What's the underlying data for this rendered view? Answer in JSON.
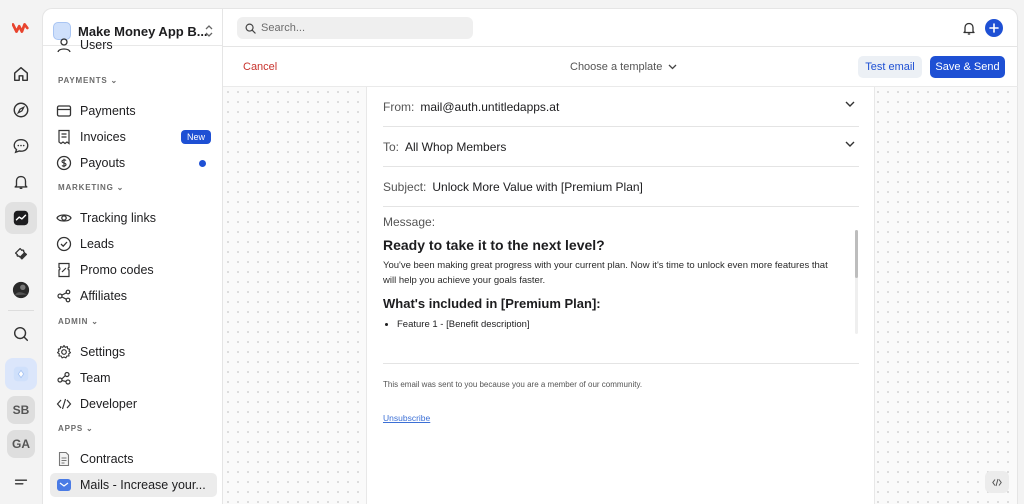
{
  "workspace": {
    "name": "Make Money App B..."
  },
  "search": {
    "placeholder": "Search..."
  },
  "sidebar": {
    "partial_item": "Users",
    "sections": [
      {
        "label": "PAYMENTS",
        "items": [
          {
            "label": "Payments",
            "icon": "credit-card-icon"
          },
          {
            "label": "Invoices",
            "icon": "receipt-icon",
            "badge": "New"
          },
          {
            "label": "Payouts",
            "icon": "dollar-circle-icon",
            "dot": true
          }
        ]
      },
      {
        "label": "MARKETING",
        "items": [
          {
            "label": "Tracking links",
            "icon": "eye-icon"
          },
          {
            "label": "Leads",
            "icon": "check-circle-icon"
          },
          {
            "label": "Promo codes",
            "icon": "ticket-icon"
          },
          {
            "label": "Affiliates",
            "icon": "share-nodes-icon"
          }
        ]
      },
      {
        "label": "ADMIN",
        "items": [
          {
            "label": "Settings",
            "icon": "gear-icon"
          },
          {
            "label": "Team",
            "icon": "team-icon"
          },
          {
            "label": "Developer",
            "icon": "code-icon"
          }
        ]
      },
      {
        "label": "APPS",
        "items": [
          {
            "label": "Contracts",
            "icon": "document-icon"
          },
          {
            "label": "Mails - Increase your...",
            "icon": "mail-app-icon",
            "active": true
          }
        ]
      }
    ]
  },
  "rail": {
    "avatars": [
      "SB",
      "GA"
    ]
  },
  "actions": {
    "cancel": "Cancel",
    "template": "Choose a template",
    "test_email": "Test email",
    "save_send": "Save & Send"
  },
  "email": {
    "from_label": "From:",
    "from_value": "mail@auth.untitledapps.at",
    "to_label": "To:",
    "to_value": "All Whop Members",
    "subject_label": "Subject:",
    "subject_value": "Unlock More Value with [Premium Plan]",
    "message_label": "Message:",
    "heading": "Ready to take it to the next level?",
    "paragraph": "You've been making great progress with your current plan. Now it's time to unlock even more features that will help you achieve your goals faster.",
    "subheading": "What's included in [Premium Plan]:",
    "bullet": "Feature 1 - [Benefit description]",
    "footer": "This email was sent to you because you are a member of our community.",
    "unsubscribe": "Unsubscribe"
  },
  "colors": {
    "accent": "#1e50d4",
    "danger": "#c8332d",
    "brand": "#e8432d"
  }
}
